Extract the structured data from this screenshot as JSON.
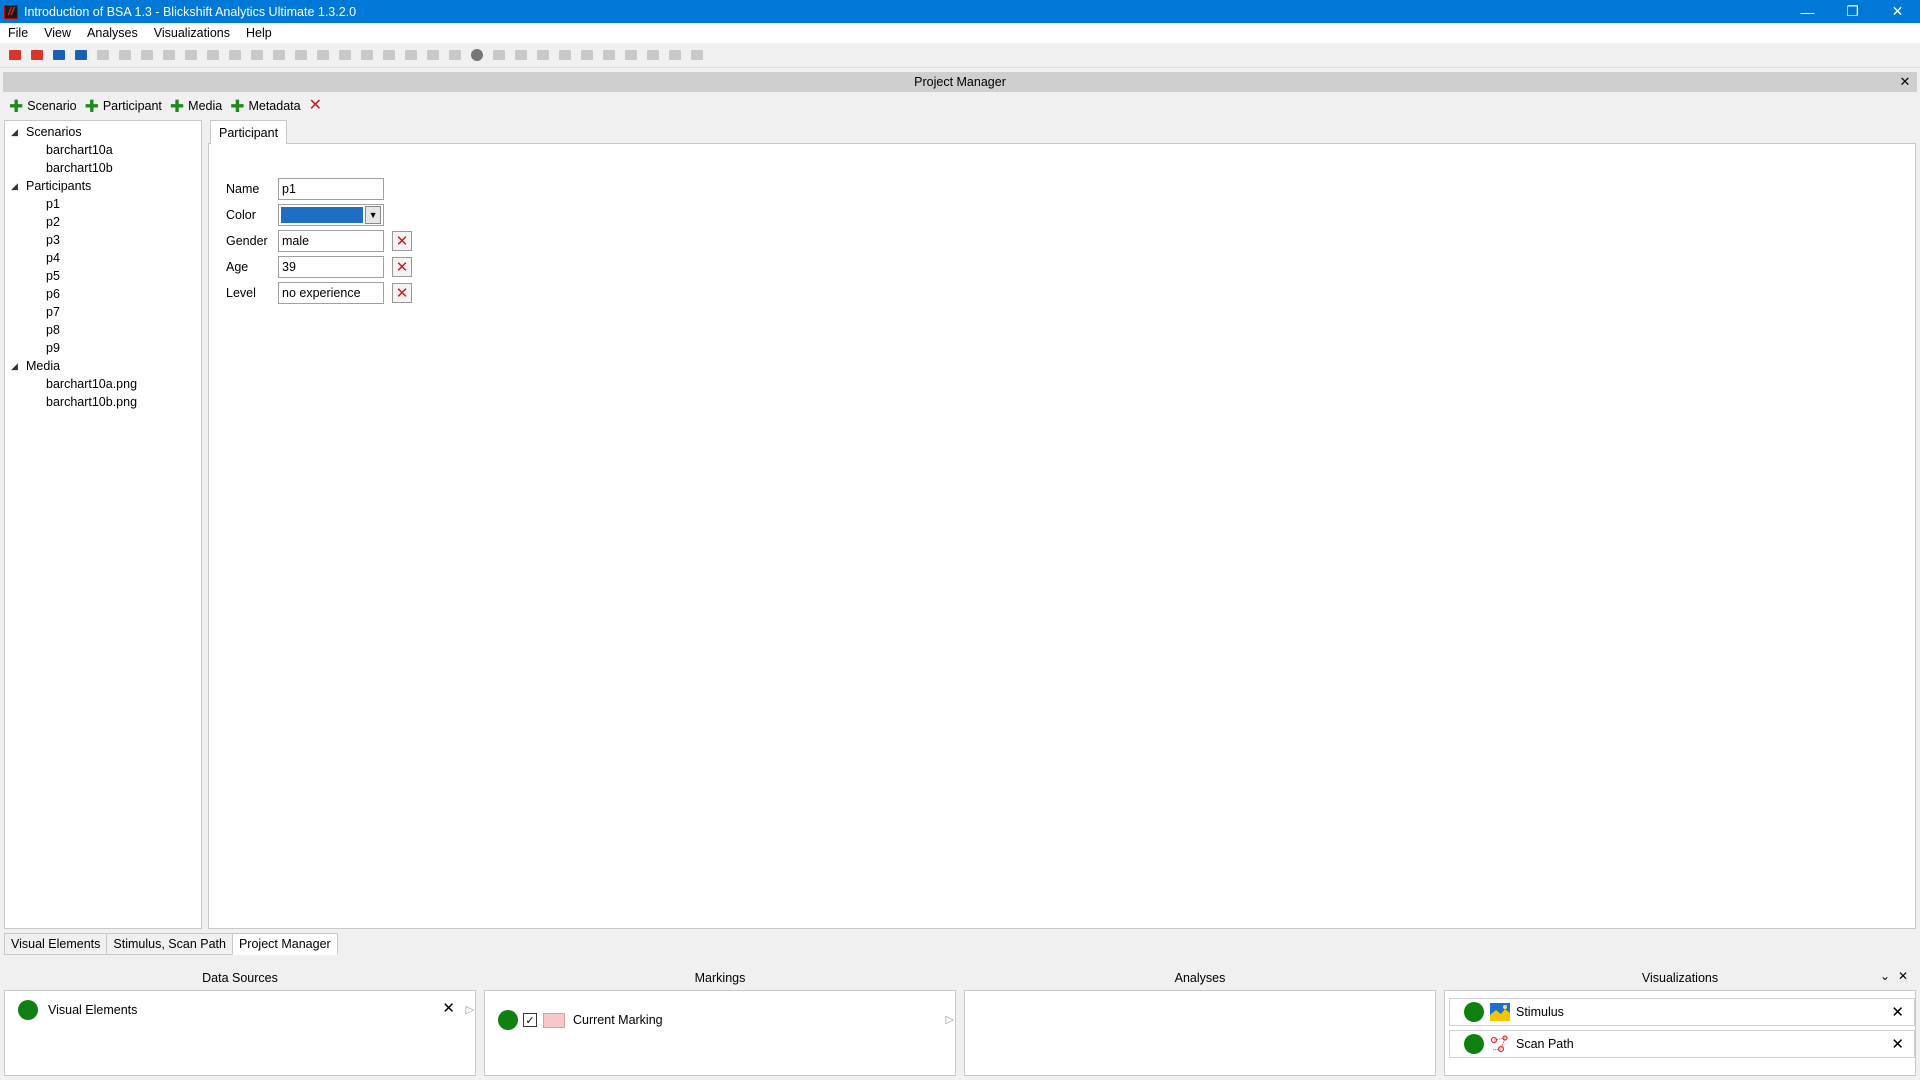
{
  "window": {
    "title": "Introduction of BSA 1.3 - Blickshift Analytics Ultimate 1.3.2.0",
    "app_icon": "//",
    "minimize_glyph": "—",
    "restore_glyph": "❐",
    "close_glyph": "✕"
  },
  "menu": [
    "File",
    "View",
    "Analyses",
    "Visualizations",
    "Help"
  ],
  "project_manager": {
    "title": "Project Manager",
    "close_glyph": "✕",
    "actions": {
      "plus_glyph": "✚",
      "scenario": "Scenario",
      "participant": "Participant",
      "media": "Media",
      "metadata": "Metadata",
      "delete_glyph": "✕"
    },
    "tree": {
      "expanded_glyph": "◢",
      "scenarios_label": "Scenarios",
      "scenarios": [
        "barchart10a",
        "barchart10b"
      ],
      "participants_label": "Participants",
      "participants": [
        "p1",
        "p2",
        "p3",
        "p4",
        "p5",
        "p6",
        "p7",
        "p8",
        "p9"
      ],
      "media_label": "Media",
      "media": [
        "barchart10a.png",
        "barchart10b.png"
      ]
    },
    "detail": {
      "tab_label": "Participant",
      "name_label": "Name",
      "name_value": "p1",
      "color_label": "Color",
      "color_value": "#1e6fc4",
      "color_dropdown_glyph": "▼",
      "gender_label": "Gender",
      "gender_value": "male",
      "age_label": "Age",
      "age_value": "39",
      "level_label": "Level",
      "level_value": "no experience",
      "remove_glyph": "✕"
    }
  },
  "bottom_tabs": [
    "Visual Elements",
    "Stimulus, Scan Path",
    "Project Manager"
  ],
  "panes": {
    "data_sources": {
      "title": "Data Sources",
      "item": "Visual Elements",
      "close_glyph": "✕",
      "play_glyph": "▷"
    },
    "markings": {
      "title": "Markings",
      "item": "Current Marking",
      "check_glyph": "✓",
      "play_glyph": "▷"
    },
    "analyses": {
      "title": "Analyses"
    },
    "visualizations": {
      "title": "Visualizations",
      "collapse_glyph": "⌄",
      "close_glyph": "✕",
      "items": [
        "Stimulus",
        "Scan Path"
      ],
      "item_close_glyph": "✕"
    }
  },
  "colors": {
    "titlebar": "#0078d7",
    "status_green": "#108010",
    "delete_red": "#c02020",
    "add_green": "#1e8b1e"
  }
}
